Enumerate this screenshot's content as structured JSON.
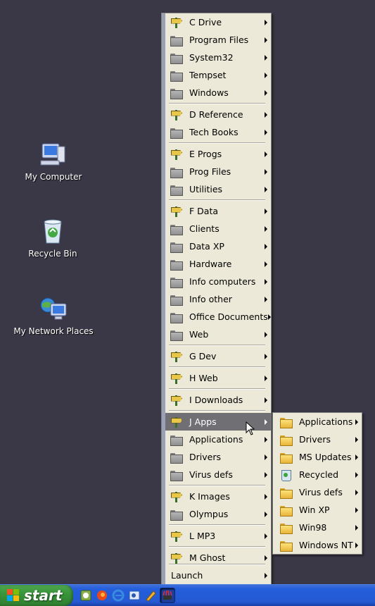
{
  "desktop": {
    "icons": [
      {
        "label": "My Computer",
        "icon": "computer-icon"
      },
      {
        "label": "Recycle Bin",
        "icon": "recycle-bin-icon"
      },
      {
        "label": "My Network Places",
        "icon": "network-places-icon"
      }
    ]
  },
  "main_menu": {
    "items": [
      {
        "label": "C Drive",
        "icon": "drive-icon"
      },
      {
        "label": "Program Files",
        "icon": "folder-icon"
      },
      {
        "label": "System32",
        "icon": "folder-icon"
      },
      {
        "label": "Tempset",
        "icon": "folder-icon"
      },
      {
        "label": "Windows",
        "icon": "folder-icon"
      },
      {
        "label": "D Reference",
        "icon": "drive-icon"
      },
      {
        "label": "Tech Books",
        "icon": "folder-icon"
      },
      {
        "label": "E Progs",
        "icon": "drive-icon"
      },
      {
        "label": "Prog Files",
        "icon": "folder-icon"
      },
      {
        "label": "Utilities",
        "icon": "folder-icon"
      },
      {
        "label": "F Data",
        "icon": "drive-icon"
      },
      {
        "label": "Clients",
        "icon": "folder-icon"
      },
      {
        "label": "Data XP",
        "icon": "folder-icon"
      },
      {
        "label": "Hardware",
        "icon": "folder-icon"
      },
      {
        "label": "Info computers",
        "icon": "folder-icon"
      },
      {
        "label": "Info other",
        "icon": "folder-icon"
      },
      {
        "label": "Office Documents",
        "icon": "folder-icon"
      },
      {
        "label": "Web",
        "icon": "folder-icon"
      },
      {
        "label": "G Dev",
        "icon": "drive-icon"
      },
      {
        "label": "H Web",
        "icon": "drive-icon"
      },
      {
        "label": "I Downloads",
        "icon": "drive-icon"
      },
      {
        "label": "J Apps",
        "icon": "drive-icon",
        "highlighted": true
      },
      {
        "label": "Applications",
        "icon": "folder-icon"
      },
      {
        "label": "Drivers",
        "icon": "folder-icon"
      },
      {
        "label": "Virus defs",
        "icon": "folder-icon"
      },
      {
        "label": "K Images",
        "icon": "drive-icon"
      },
      {
        "label": "Olympus",
        "icon": "folder-icon"
      },
      {
        "label": "L MP3",
        "icon": "drive-icon"
      },
      {
        "label": "M Ghost",
        "icon": "drive-icon"
      },
      {
        "label": "Launch",
        "icon": ""
      }
    ]
  },
  "sub_menu": {
    "items": [
      {
        "label": "Applications",
        "icon": "folder-icon"
      },
      {
        "label": "Drivers",
        "icon": "folder-icon"
      },
      {
        "label": "MS Updates",
        "icon": "folder-icon"
      },
      {
        "label": "Recycled",
        "icon": "recycle-icon"
      },
      {
        "label": "Virus defs",
        "icon": "folder-icon"
      },
      {
        "label": "Win XP",
        "icon": "folder-icon"
      },
      {
        "label": "Win98",
        "icon": "folder-icon"
      },
      {
        "label": "Windows NT",
        "icon": "folder-icon"
      }
    ]
  },
  "taskbar": {
    "start_label": "start",
    "quick_launch": [
      "quick-launch-app-icon",
      "firefox-icon",
      "internet-explorer-icon",
      "outlook-icon",
      "pencil-icon",
      "show-desktop-icon"
    ]
  },
  "colors": {
    "desktop": "#3a3846",
    "menu": "#ece9d8",
    "highlight": "#6f6f74",
    "taskbar": "#245edb",
    "start": "#3a963a"
  }
}
